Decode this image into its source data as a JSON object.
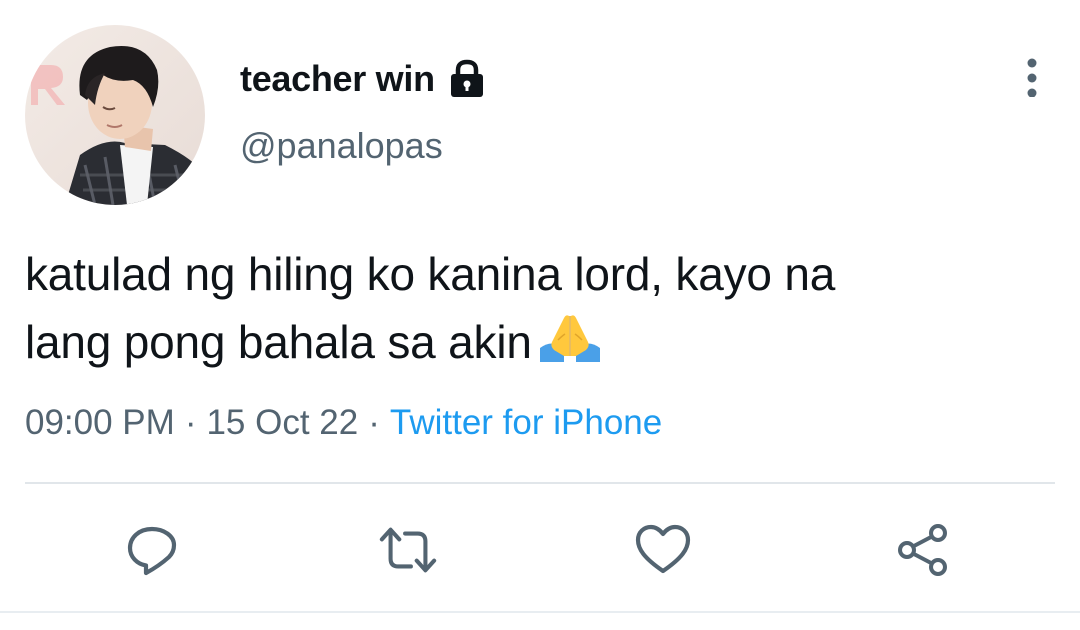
{
  "tweet": {
    "display_name": "teacher win",
    "handle": "@panalopas",
    "protected_icon": "lock-icon",
    "text_line_1": "katulad ng hiling ko kanina lord, kayo na",
    "text_line_2": "lang pong bahala sa akin",
    "emoji_icon": "folded-hands-icon",
    "time": "09:00 PM",
    "separator": "·",
    "date": "15 Oct 22",
    "source": "Twitter for iPhone"
  },
  "actions": {
    "icons": [
      "reply-icon",
      "retweet-icon",
      "like-icon",
      "share-icon"
    ]
  },
  "colors": {
    "text": "#0f1419",
    "secondary_text": "#536471",
    "link": "#1d9bf0",
    "icon": "#536471",
    "divider": "#e1e6ea"
  }
}
